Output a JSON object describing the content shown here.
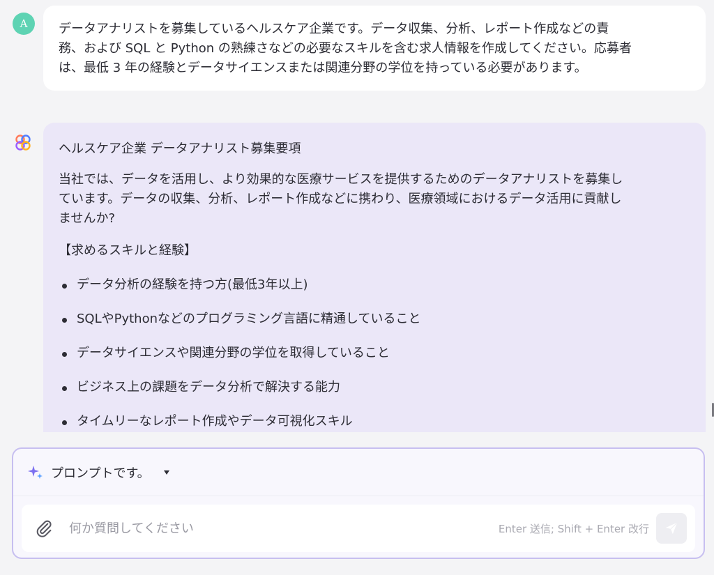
{
  "user": {
    "avatar_initial": "A",
    "message_lines": [
      "データアナリストを募集しているヘルスケア企業です。データ収集、分析、レポート作成などの責",
      "務、および SQL と Python の熟練さなどの必要なスキルを含む求人情報を作成してください。応募者",
      "は、最低 3 年の経験とデータサイエンスまたは関連分野の学位を持っている必要があります。"
    ]
  },
  "assistant": {
    "icon": "flower-logo-icon",
    "title": "ヘルスケア企業 データアナリスト募集要項",
    "intro_lines": [
      "当社では、データを活用し、より効果的な医療サービスを提供するためのデータアナリストを募集し",
      "ています。データの収集、分析、レポート作成などに携わり、医療領域におけるデータ活用に貢献し",
      "ませんか?"
    ],
    "section_heading": "【求めるスキルと経験】",
    "bullets": [
      "データ分析の経験を持つ方(最低3年以上)",
      "SQLやPythonなどのプログラミング言語に精通していること",
      "データサイエンスや関連分野の学位を取得していること",
      "ビジネス上の課題をデータ分析で解決する能力",
      "タイムリーなレポート作成やデータ可視化スキル"
    ]
  },
  "composer": {
    "prompt_label": "プロンプトです。",
    "placeholder": "何か質問してください",
    "hint": "Enter 送信; Shift + Enter 改行"
  },
  "colors": {
    "avatar": "#5ed3b3",
    "assistant_bubble": "#ebe7f8",
    "composer_border": "#c7bff0",
    "sparkle": "#7b6ff0"
  }
}
